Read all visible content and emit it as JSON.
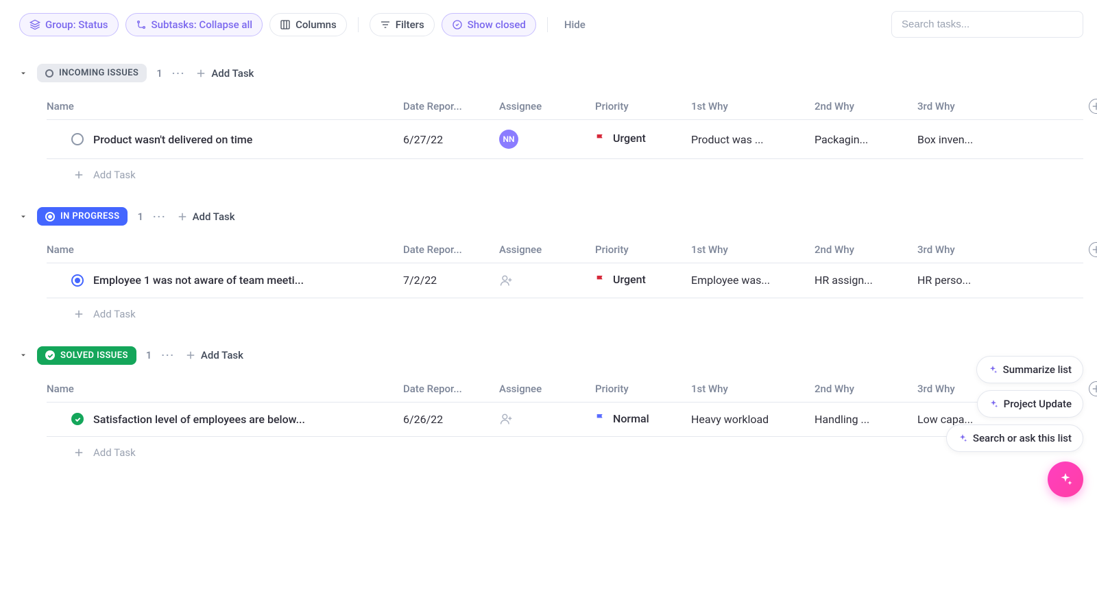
{
  "toolbar": {
    "group_label": "Group: Status",
    "subtasks_label": "Subtasks: Collapse all",
    "columns_label": "Columns",
    "filters_label": "Filters",
    "show_closed_label": "Show closed",
    "hide_label": "Hide",
    "search_placeholder": "Search tasks..."
  },
  "columns": {
    "name": "Name",
    "date_reported": "Date Repor...",
    "assignee": "Assignee",
    "priority": "Priority",
    "why1": "1st Why",
    "why2": "2nd Why",
    "why3": "3rd Why"
  },
  "add_task_label": "Add Task",
  "groups": [
    {
      "status_title": "INCOMING ISSUES",
      "style": "grey",
      "count": "1",
      "tasks": [
        {
          "status": "open",
          "name": "Product wasn't delivered on time",
          "date": "6/27/22",
          "assignee": {
            "type": "avatar",
            "initials": "NN"
          },
          "priority": {
            "level": "Urgent",
            "color": "red"
          },
          "why1": "Product was ...",
          "why2": "Packagin...",
          "why3": "Box inven..."
        }
      ]
    },
    {
      "status_title": "IN PROGRESS",
      "style": "blue",
      "count": "1",
      "tasks": [
        {
          "status": "progress",
          "name": "Employee 1 was not aware of team meeti...",
          "date": "7/2/22",
          "assignee": {
            "type": "empty"
          },
          "priority": {
            "level": "Urgent",
            "color": "red"
          },
          "why1": "Employee was...",
          "why2": "HR assign...",
          "why3": "HR perso..."
        }
      ]
    },
    {
      "status_title": "SOLVED ISSUES",
      "style": "green",
      "count": "1",
      "tasks": [
        {
          "status": "done",
          "name": "Satisfaction level of employees are below...",
          "date": "6/26/22",
          "assignee": {
            "type": "empty"
          },
          "priority": {
            "level": "Normal",
            "color": "blue"
          },
          "why1": "Heavy workload",
          "why2": "Handling ...",
          "why3": "Low capa..."
        }
      ]
    }
  ],
  "ai": {
    "summarize": "Summarize list",
    "project_update": "Project Update",
    "search_ask": "Search or ask this list"
  }
}
